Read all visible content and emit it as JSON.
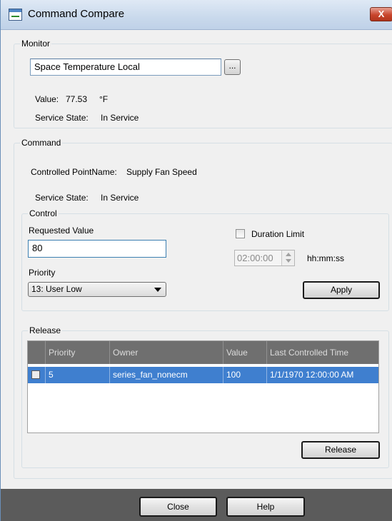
{
  "window": {
    "title": "Command Compare",
    "close_glyph": "X"
  },
  "monitor": {
    "legend": "Monitor",
    "point_name": "Space Temperature Local",
    "browse_label": "...",
    "value_label": "Value:",
    "value": "77.53",
    "unit": "°F",
    "service_state_label": "Service State:",
    "service_state": "In Service"
  },
  "command": {
    "legend": "Command",
    "controlled_point_label": "Controlled PointName:",
    "controlled_point": "Supply Fan Speed",
    "service_state_label": "Service State:",
    "service_state": "In Service"
  },
  "control": {
    "legend": "Control",
    "requested_value_label": "Requested Value",
    "requested_value": "80",
    "priority_label": "Priority",
    "priority_selected": "13: User Low",
    "duration_limit_label": "Duration Limit",
    "duration_limit_checked": false,
    "duration_value": "02:00:00",
    "duration_unit": "hh:mm:ss",
    "apply_label": "Apply"
  },
  "release": {
    "legend": "Release",
    "columns": [
      "Priority",
      "Owner",
      "Value",
      "Last Controlled Time"
    ],
    "rows": [
      {
        "priority": "5",
        "owner": "series_fan_nonecm",
        "value": "100",
        "time": "1/1/1970 12:00:00 AM",
        "selected": true
      }
    ],
    "release_label": "Release"
  },
  "footer": {
    "close_label": "Close",
    "help_label": "Help"
  },
  "icons": [
    "app-icon",
    "close-icon",
    "spinner-icon",
    "dropdown-arrow-icon"
  ]
}
